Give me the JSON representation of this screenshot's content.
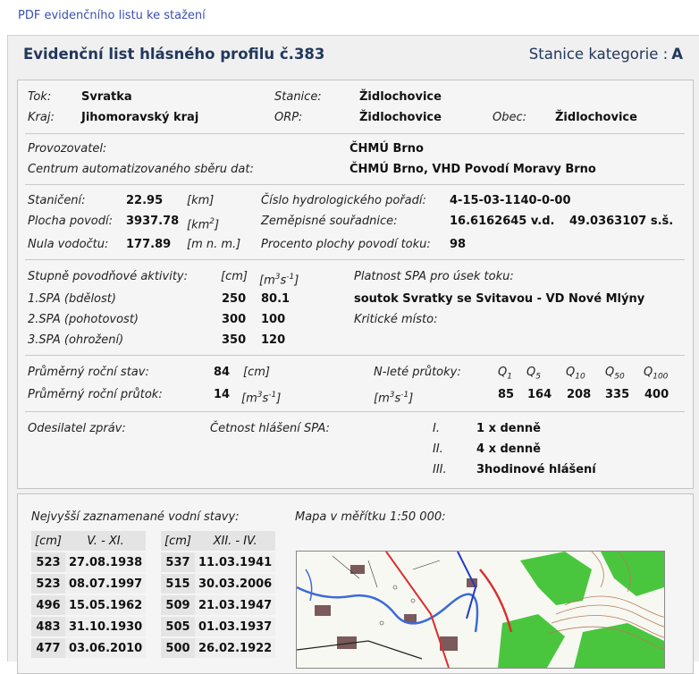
{
  "top_link": "PDF evidenčního listu ke stažení",
  "header": {
    "title": "Evidenční list hlásného profilu č.383",
    "category_label": "Stanice kategorie :",
    "category_value": "A"
  },
  "location": {
    "tok_label": "Tok:",
    "tok_value": "Svratka",
    "stanice_label": "Stanice:",
    "stanice_value": "Židlochovice",
    "kraj_label": "Kraj:",
    "kraj_value": "Jihomoravský kraj",
    "orp_label": "ORP:",
    "orp_value": "Židlochovice",
    "obec_label": "Obec:",
    "obec_value": "Židlochovice"
  },
  "operator": {
    "provozovatel_label": "Provozovatel:",
    "provozovatel_value": "ČHMÚ Brno",
    "centrum_label": "Centrum automatizovaného sběru dat:",
    "centrum_value": "ČHMÚ Brno, VHD Povodí Moravy Brno"
  },
  "hydro": {
    "staniceni_label": "Staničení:",
    "staniceni_value": "22.95",
    "staniceni_unit": "[km]",
    "plocha_label": "Plocha povodí:",
    "plocha_value": "3937.78",
    "plocha_unit_a": "[km",
    "plocha_unit_sup": "2",
    "plocha_unit_b": "]",
    "nula_label": "Nula vodočtu:",
    "nula_value": "177.89",
    "nula_unit": "[m n. m.]",
    "cislo_label": "Číslo hydrologického pořadí:",
    "cislo_value": "4-15-03-1140-0-00",
    "souradnice_label": "Zeměpisné souřadnice:",
    "souradnice_lon": "16.6162645 v.d.",
    "souradnice_lat": "49.0363107 s.š.",
    "procento_label": "Procento plochy povodí toku:",
    "procento_value": "98"
  },
  "spa": {
    "heading": "Stupně povodňové aktivity:",
    "unit_cm": "[cm]",
    "unit_m": "[m",
    "unit_m_sup": "3",
    "unit_s": "s",
    "unit_s_sup": "-1",
    "unit_close": "]",
    "rows": [
      {
        "label": "1.SPA (bdělost)",
        "cm": "250",
        "q": "80.1"
      },
      {
        "label": "2.SPA (pohotovost)",
        "cm": "300",
        "q": "100"
      },
      {
        "label": "3.SPA (ohrožení)",
        "cm": "350",
        "q": "120"
      }
    ],
    "platnost_label": "Platnost SPA pro úsek toku:",
    "platnost_value": "soutok Svratky se Svitavou - VD Nové Mlýny",
    "kriticke_label": "Kritické místo:"
  },
  "flows": {
    "stav_label": "Průměrný roční stav:",
    "stav_value": "84",
    "stav_unit": "[cm]",
    "prutok_label": "Průměrný roční průtok:",
    "prutok_value": "14",
    "nlete_label": "N-leté průtoky:",
    "q_sub": [
      "1",
      "5",
      "10",
      "50",
      "100"
    ],
    "q_values": [
      "85",
      "164",
      "208",
      "335",
      "400"
    ]
  },
  "reporting": {
    "odesilatel_label": "Odesilatel zpráv:",
    "cetnost_label": "Četnost hlášení SPA:",
    "rows": [
      {
        "level": "I.",
        "value": "1 x denně"
      },
      {
        "level": "II.",
        "value": "4 x denně"
      },
      {
        "level": "III.",
        "value": "3hodinové hlášení"
      }
    ]
  },
  "records": {
    "heading": "Nejvyšší zaznamenané vodní stavy:",
    "map_heading": "Mapa v měřítku 1:50 000:",
    "col_cm": "[cm]",
    "period1": "V. - XI.",
    "period2": "XII. - IV.",
    "rows": [
      {
        "cm1": "523",
        "d1": "27.08.1938",
        "cm2": "537",
        "d2": "11.03.1941"
      },
      {
        "cm1": "523",
        "d1": "08.07.1997",
        "cm2": "515",
        "d2": "30.03.2006"
      },
      {
        "cm1": "496",
        "d1": "15.05.1962",
        "cm2": "509",
        "d2": "21.03.1947"
      },
      {
        "cm1": "483",
        "d1": "31.10.1930",
        "cm2": "505",
        "d2": "01.03.1937"
      },
      {
        "cm1": "477",
        "d1": "03.06.2010",
        "cm2": "500",
        "d2": "26.02.1922"
      }
    ]
  }
}
